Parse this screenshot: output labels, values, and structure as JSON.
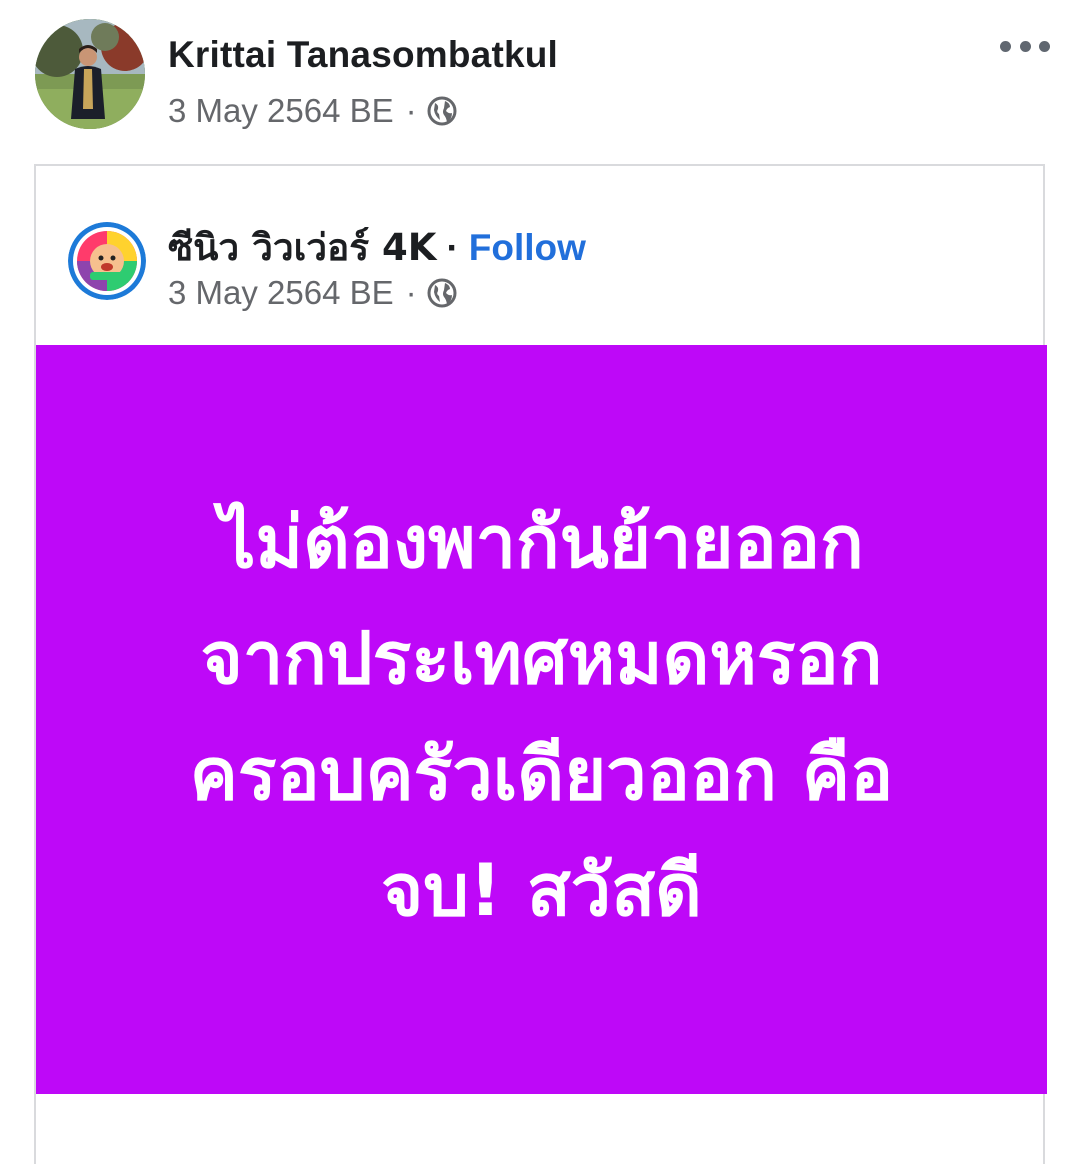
{
  "post": {
    "author_name": "Krittai Tanasombatkul",
    "date": "3 May 2564 BE",
    "separator": "·",
    "privacy_icon": "globe-icon",
    "more_icon": "more-horizontal-icon"
  },
  "shared_post": {
    "page_name": "ซีนิว วิวเว่อร์ 4K",
    "separator": "·",
    "follow_label": "Follow",
    "date": "3 May 2564 BE",
    "privacy_icon": "globe-icon",
    "status_lines": [
      "ไม่ต้องพากันย้ายออก",
      "จากประเทศหมดหรอก",
      "ครอบครัวเดียวออก คือ",
      "จบ! สวัสดี"
    ],
    "background_color": "#be08f8",
    "text_color": "#ffffff",
    "link_color": "#216fdb"
  }
}
